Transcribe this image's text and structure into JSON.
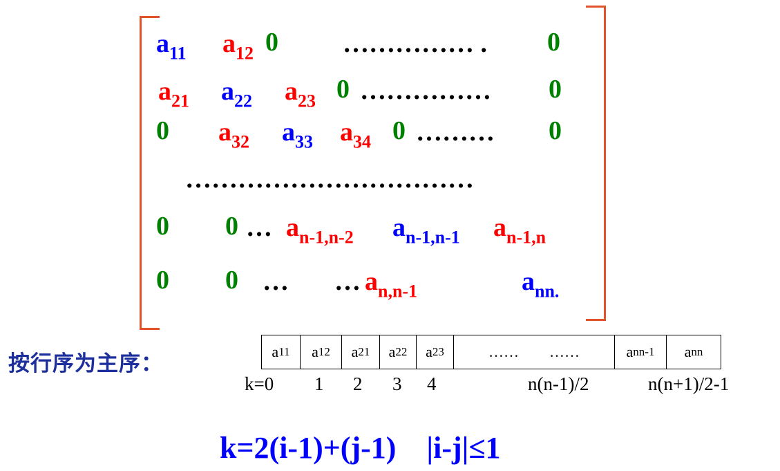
{
  "matrix": {
    "row1": [
      {
        "t": "a",
        "s": "11",
        "c": "blue"
      },
      {
        "t": "a",
        "s": "12",
        "c": "red"
      },
      {
        "t": "0",
        "c": "green"
      },
      {
        "t": "…………… .",
        "c": "black"
      },
      {
        "t": "0",
        "c": "green"
      }
    ],
    "row2": [
      {
        "t": "a",
        "s": "21",
        "c": "red"
      },
      {
        "t": "a",
        "s": "22",
        "c": "blue"
      },
      {
        "t": "a",
        "s": "23",
        "c": "red"
      },
      {
        "t": "0",
        "c": "green"
      },
      {
        "t": "……………",
        "c": "black"
      },
      {
        "t": "0",
        "c": "green"
      }
    ],
    "row3": [
      {
        "t": "0",
        "c": "green"
      },
      {
        "t": "a",
        "s": "32",
        "c": "red"
      },
      {
        "t": "a",
        "s": "33",
        "c": "blue"
      },
      {
        "t": "a",
        "s": "34",
        "c": "red"
      },
      {
        "t": "0",
        "c": "green"
      },
      {
        "t": "………",
        "c": "black"
      },
      {
        "t": "0",
        "c": "green"
      }
    ],
    "row4": [
      {
        "t": "……………………………",
        "c": "black"
      }
    ],
    "row5": [
      {
        "t": "0",
        "c": "green"
      },
      {
        "t": "0",
        "c": "green"
      },
      {
        "t": "…",
        "c": "black"
      },
      {
        "t": "a",
        "s": "n-1,n-2",
        "c": "red"
      },
      {
        "t": "a",
        "s": "n-1,n-1",
        "c": "blue"
      },
      {
        "t": "a",
        "s": "n-1,n",
        "c": "red"
      }
    ],
    "row6": [
      {
        "t": "0",
        "c": "green"
      },
      {
        "t": "0",
        "c": "green"
      },
      {
        "t": "…",
        "c": "black"
      },
      {
        "t": "…",
        "c": "black"
      },
      {
        "t": "a",
        "s": "n,n-1",
        "c": "red"
      },
      {
        "t": "a",
        "s": "nn.",
        "c": "blue"
      }
    ]
  },
  "label": "按行序为主序：",
  "storage": [
    {
      "t": "a",
      "s": "11"
    },
    {
      "t": "a",
      "s": "12"
    },
    {
      "t": "a",
      "s": "21"
    },
    {
      "t": "a",
      "s": "22"
    },
    {
      "t": "a",
      "s": "23"
    },
    {
      "t": "……        ……"
    },
    {
      "t": "a",
      "s": "nn-1"
    },
    {
      "t": "a",
      "s": "nn"
    }
  ],
  "k_labels": [
    "k=0",
    "1",
    "2",
    "3",
    "4",
    "n(n-1)/2",
    "n(n+1)/2-1"
  ],
  "formula": "k=2(i-1)+(j-1)    |i-j|≤1"
}
